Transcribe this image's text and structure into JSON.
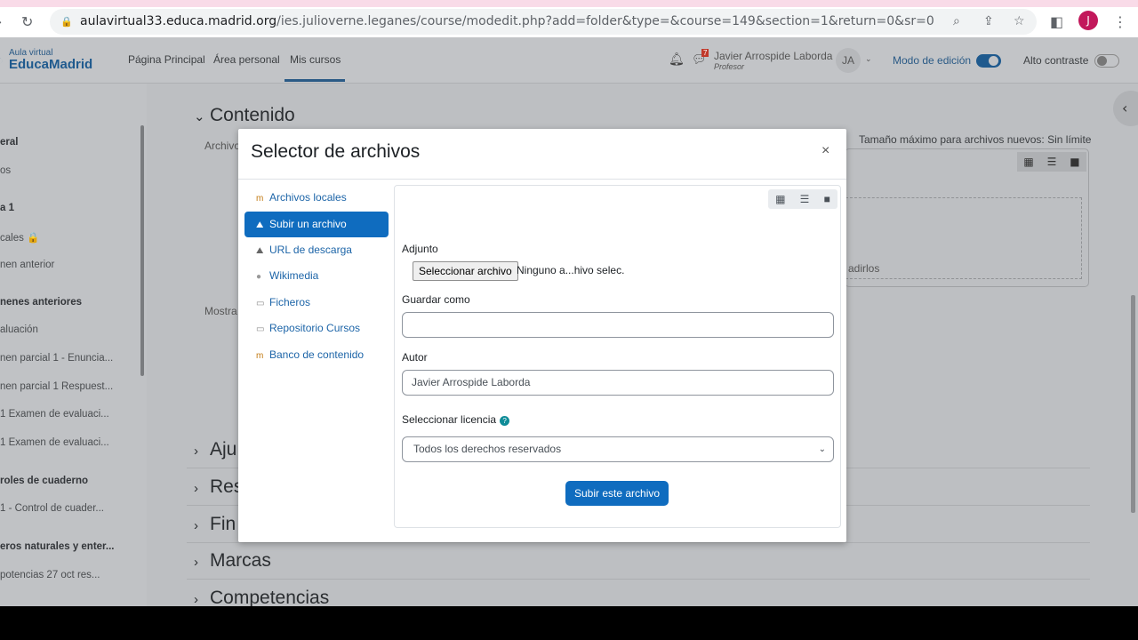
{
  "browser": {
    "url_host": "aulavirtual33.educa.madrid.org",
    "url_path": "/ies.julioverne.leganes/course/modedit.php?add=folder&type=&course=149&section=1&return=0&sr=0",
    "profile_initial": "J"
  },
  "navbar": {
    "logo_small": "Aula virtual",
    "logo_big": "EducaMadrid",
    "links": [
      "Página Principal",
      "Área personal",
      "Mis cursos"
    ],
    "notifications_count": "7",
    "user_name": "Javier Arrospide Laborda",
    "user_role": "Profesor",
    "user_initials": "JA",
    "edit_mode_label": "Modo de edición",
    "edit_mode_on": true,
    "contrast_label": "Alto contraste",
    "contrast_on": false
  },
  "drawer": {
    "items": [
      {
        "label": "eral",
        "bold": true
      },
      {
        "label": "os",
        "bold": false
      },
      {
        "label": "a 1",
        "bold": true
      },
      {
        "label": "cales 🔒",
        "bold": false
      },
      {
        "label": "nen anterior",
        "bold": false
      },
      {
        "label": "nenes anteriores",
        "bold": true
      },
      {
        "label": "aluación",
        "bold": false
      },
      {
        "label": "nen parcial 1 - Enuncia...",
        "bold": false
      },
      {
        "label": "nen parcial 1 Respuest...",
        "bold": false
      },
      {
        "label": "1 Examen de evaluaci...",
        "bold": false
      },
      {
        "label": "1 Examen de evaluaci...",
        "bold": false
      },
      {
        "label": "roles de cuaderno",
        "bold": true
      },
      {
        "label": "1 - Control de cuader...",
        "bold": false
      },
      {
        "label": "eros naturales y enter...",
        "bold": true
      },
      {
        "label": "potencias 27 oct res...",
        "bold": false
      }
    ]
  },
  "background": {
    "section_title": "Contenido",
    "field_archivos": "Archivo",
    "field_mostrar": "Mostra",
    "max_size": "Tamaño máximo para archivos nuevos: Sin límite",
    "drop_text": "adirlos",
    "sections": [
      "Aju",
      "Res",
      "Fin",
      "Marcas",
      "Competencias"
    ]
  },
  "modal": {
    "title": "Selector de archivos",
    "close": "×",
    "repositories": [
      {
        "label": "Archivos locales",
        "icon": "moodle-icon",
        "active": false
      },
      {
        "label": "Subir un archivo",
        "icon": "upload-icon",
        "active": true
      },
      {
        "label": "URL de descarga",
        "icon": "url-download-icon",
        "active": false
      },
      {
        "label": "Wikimedia",
        "icon": "wikimedia-icon",
        "active": false
      },
      {
        "label": "Ficheros",
        "icon": "folder-icon",
        "active": false
      },
      {
        "label": "Repositorio Cursos",
        "icon": "folder-icon",
        "active": false
      },
      {
        "label": "Banco de contenido",
        "icon": "moodle-icon",
        "active": false
      }
    ],
    "attachment_label": "Adjunto",
    "choose_file": "Seleccionar archivo",
    "no_file": "Ninguno a...hivo selec.",
    "save_as_label": "Guardar como",
    "save_as_value": "",
    "author_label": "Autor",
    "author_value": "Javier Arrospide Laborda",
    "license_label": "Seleccionar licencia",
    "license_value": "Todos los derechos reservados",
    "submit": "Subir este archivo"
  },
  "colors": {
    "primary": "#0f6cbf",
    "overlay": "#bdbfc2"
  }
}
